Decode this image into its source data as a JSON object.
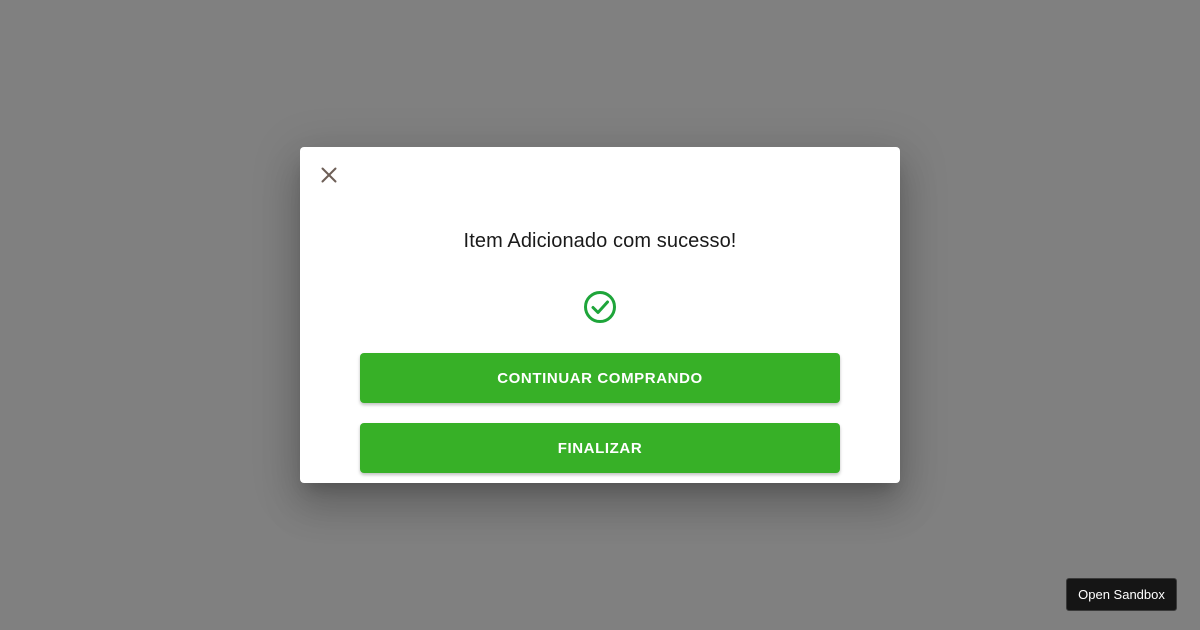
{
  "dialog": {
    "title": "Item Adicionado com sucesso!",
    "close_icon": "close-icon",
    "success_icon": "check-circle-icon",
    "continue_label": "CONTINUAR COMPRANDO",
    "finish_label": "FINALIZAR"
  },
  "sandbox": {
    "open_label": "Open Sandbox"
  },
  "colors": {
    "backdrop": "#808080",
    "button_green": "#37b027",
    "check_green": "#1ea53a",
    "close_gray": "#6d5f57"
  }
}
